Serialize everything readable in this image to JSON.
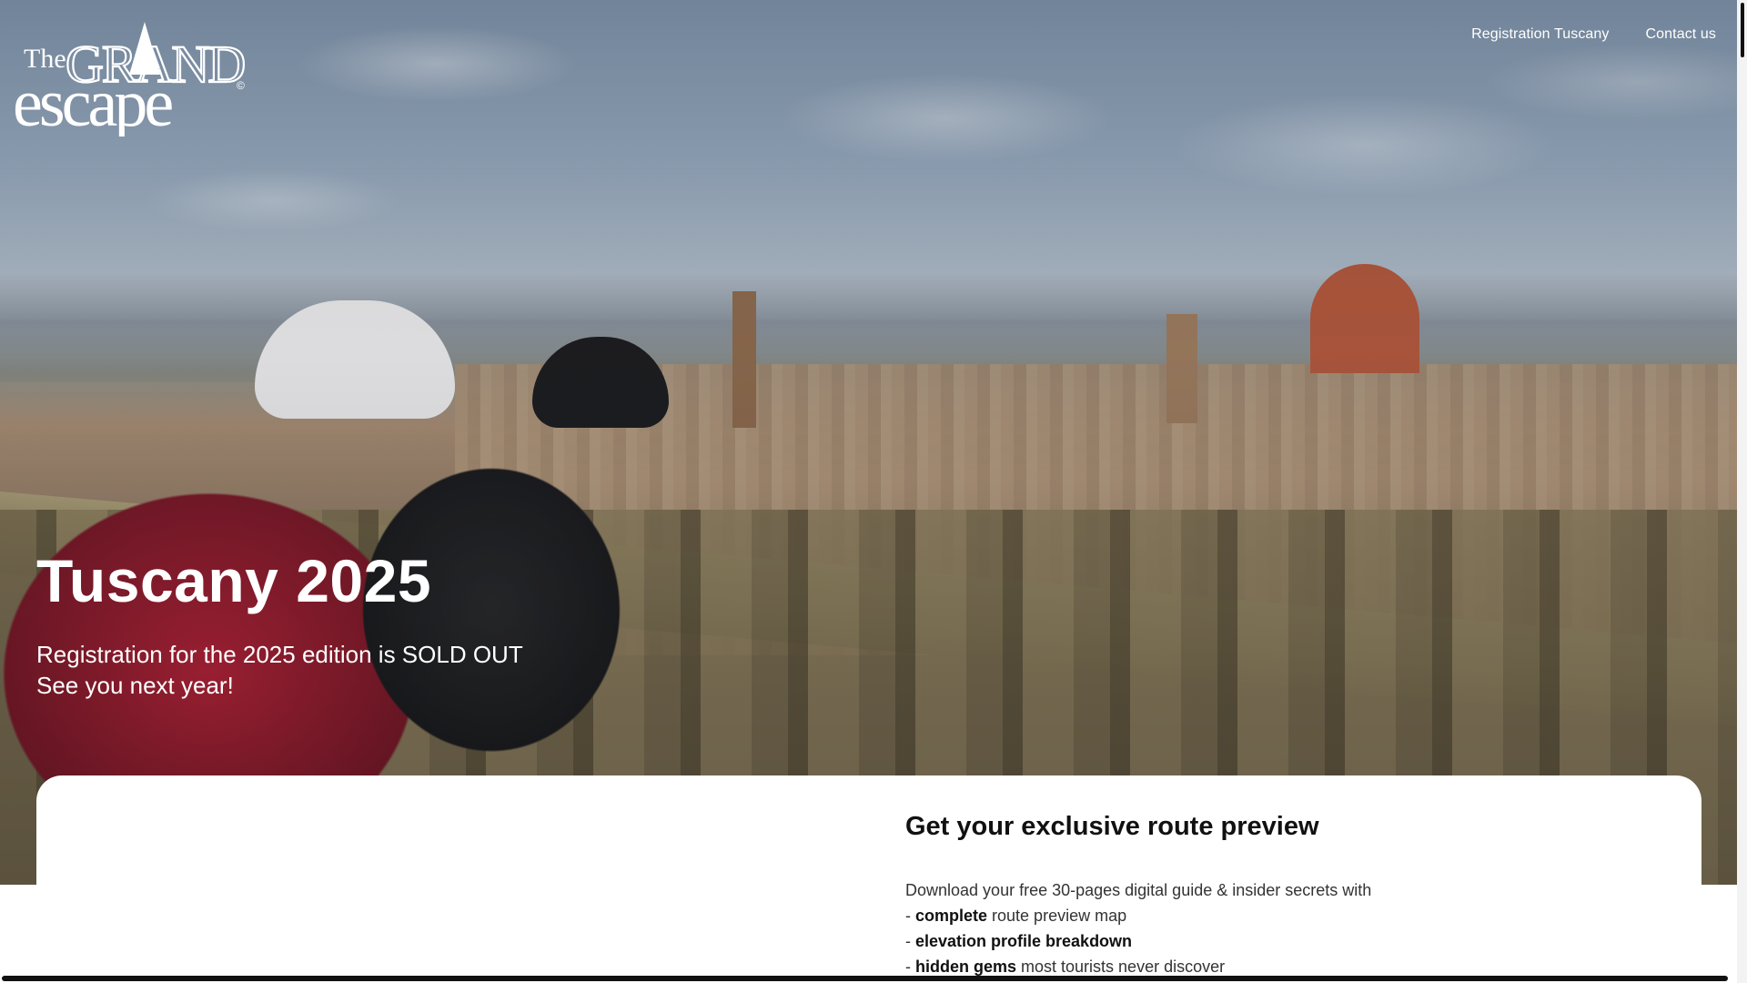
{
  "logo": {
    "line1": "The",
    "line2": "GRAND",
    "line3": "escape",
    "mark": "©"
  },
  "nav": {
    "registration": "Registration Tuscany",
    "contact": "Contact us"
  },
  "hero": {
    "title": "Tuscany 2025",
    "line1": "Registration for the 2025 edition is SOLD OUT",
    "line2": "See you next year!"
  },
  "preview": {
    "title": "Get your exclusive route preview",
    "intro": "Download your free 30-pages digital guide & insider secrets with",
    "items": [
      {
        "prefix": "- ",
        "bold": "complete",
        "rest": " route preview map"
      },
      {
        "prefix": "- ",
        "bold": "elevation profile breakdown",
        "rest": ""
      },
      {
        "prefix": "- ",
        "bold": "hidden gems",
        "rest": " most tourists never discover"
      }
    ]
  },
  "colors": {
    "text_on_hero": "#ffffff",
    "card_bg": "#ffffff",
    "heading": "#111111",
    "body": "#333333"
  }
}
